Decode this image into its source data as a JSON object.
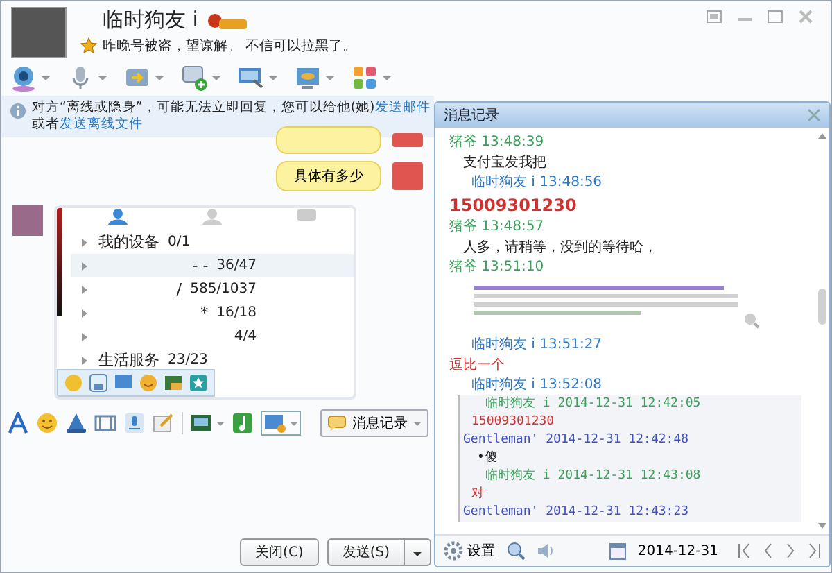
{
  "contact": {
    "name": "临时狗友 i",
    "status": "昨晚号被盗，望谅解。 不信可以拉黑了。"
  },
  "notice": {
    "text": "对方“离线或隐身”，可能无法立即回复，您可以给他(她)",
    "link": "发送邮件",
    "text2": "或者",
    "link2": "发送离线文件"
  },
  "bubbles": [
    {
      "partial": true
    },
    {
      "text": "具体有多少",
      "partial": false
    }
  ],
  "shared_screenshot": {
    "rows": [
      {
        "kind": "named",
        "label": "我的设备",
        "count": "0/1",
        "selected": false
      },
      {
        "kind": "masked",
        "label": "- -",
        "count": "36/47",
        "selected": true
      },
      {
        "kind": "masked",
        "label": "/",
        "count": "585/1037",
        "selected": false
      },
      {
        "kind": "masked",
        "label": "*",
        "count": "16/18",
        "selected": false
      },
      {
        "kind": "masked",
        "count": "4/4",
        "selected": false
      },
      {
        "kind": "named",
        "label": "生活服务",
        "count": "23/23",
        "selected": false
      }
    ]
  },
  "history_button": "消息记录",
  "buttons": {
    "close": "关闭(C)",
    "send": "发送(S)"
  },
  "history": {
    "title": "消息记录",
    "messages": [
      {
        "sender": "猪爷",
        "time": "13:48:39",
        "self": false,
        "content": [
          {
            "kind": "text",
            "text": "支付宝发我把"
          }
        ]
      },
      {
        "sender": "临时狗友 i",
        "time": "13:48:56",
        "self": true,
        "content": [
          {
            "kind": "text",
            "text": "15009301230",
            "large": true
          }
        ]
      },
      {
        "sender": "猪爷",
        "time": "13:48:57",
        "self": false,
        "content": [
          {
            "kind": "text",
            "text": "人多，请稍等，没到的等待哈，"
          }
        ]
      },
      {
        "sender": "猪爷",
        "time": "13:51:10",
        "self": false,
        "content": [
          {
            "kind": "image"
          }
        ]
      },
      {
        "sender": "临时狗友 i",
        "time": "13:51:27",
        "self": true,
        "content": [
          {
            "kind": "text",
            "text": "逗比一个"
          }
        ]
      },
      {
        "sender": "临时狗友 i",
        "time": "13:52:08",
        "self": true,
        "content": [
          {
            "kind": "quote",
            "lines": [
              {
                "kind": "me-header",
                "text": "临时狗友 i 2014-12-31 12:42:05"
              },
              {
                "kind": "me-text",
                "text": "15009301230"
              },
              {
                "kind": "other-header",
                "text": "Gentleman' 2014-12-31 12:42:48"
              },
              {
                "kind": "other-text",
                "text": "•傻"
              },
              {
                "kind": "me-header",
                "text": "临时狗友 i 2014-12-31 12:43:08"
              },
              {
                "kind": "me-text",
                "text": "对"
              },
              {
                "kind": "other-header",
                "text": "Gentleman' 2014-12-31 12:43:23"
              }
            ]
          }
        ]
      }
    ],
    "settings": "设置",
    "date": "2014-12-31"
  }
}
